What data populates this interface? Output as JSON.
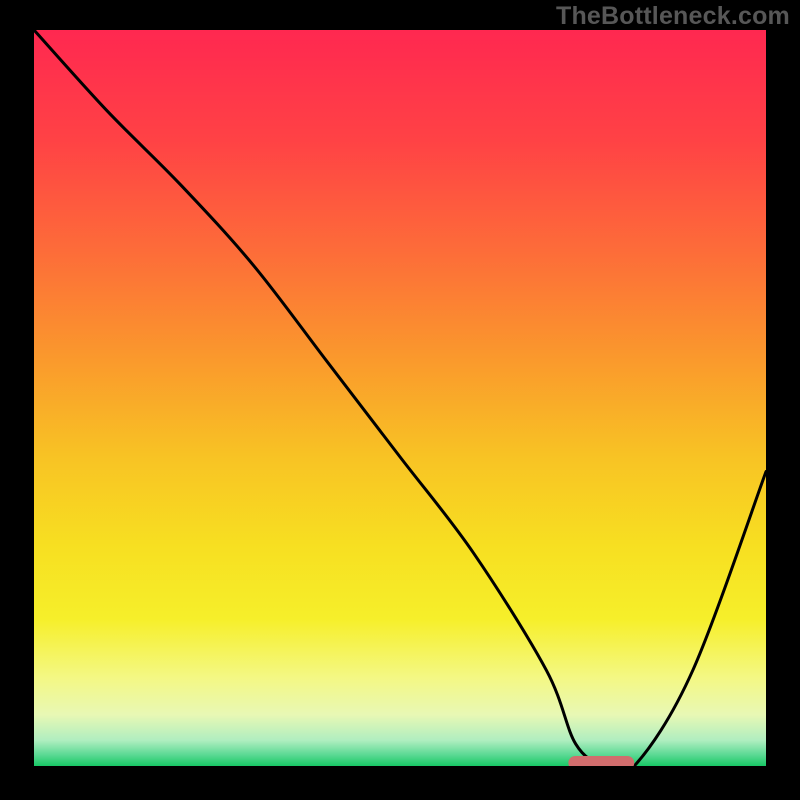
{
  "watermark": "TheBottleneck.com",
  "chart_data": {
    "type": "line",
    "title": "",
    "xlabel": "",
    "ylabel": "",
    "xlim": [
      0,
      100
    ],
    "ylim": [
      0,
      100
    ],
    "grid": false,
    "series": [
      {
        "name": "bottleneck-curve",
        "x": [
          0,
          10,
          20,
          30,
          40,
          50,
          60,
          70,
          74,
          78,
          82,
          90,
          100
        ],
        "values": [
          100,
          89,
          79,
          68,
          55,
          42,
          29,
          13,
          3,
          0,
          0,
          13,
          40
        ]
      }
    ],
    "marker": {
      "x_start": 73,
      "x_end": 82,
      "y": 0,
      "color": "#d16d6d"
    },
    "gradient_stops": [
      {
        "offset": 0.0,
        "color": "#ff2850"
      },
      {
        "offset": 0.15,
        "color": "#ff4245"
      },
      {
        "offset": 0.3,
        "color": "#fd6c39"
      },
      {
        "offset": 0.45,
        "color": "#fa9a2c"
      },
      {
        "offset": 0.58,
        "color": "#f8c324"
      },
      {
        "offset": 0.7,
        "color": "#f7df21"
      },
      {
        "offset": 0.8,
        "color": "#f6ef2a"
      },
      {
        "offset": 0.88,
        "color": "#f4f884"
      },
      {
        "offset": 0.93,
        "color": "#e8f8b4"
      },
      {
        "offset": 0.965,
        "color": "#b0eec0"
      },
      {
        "offset": 0.985,
        "color": "#5ad993"
      },
      {
        "offset": 1.0,
        "color": "#18c866"
      }
    ]
  }
}
